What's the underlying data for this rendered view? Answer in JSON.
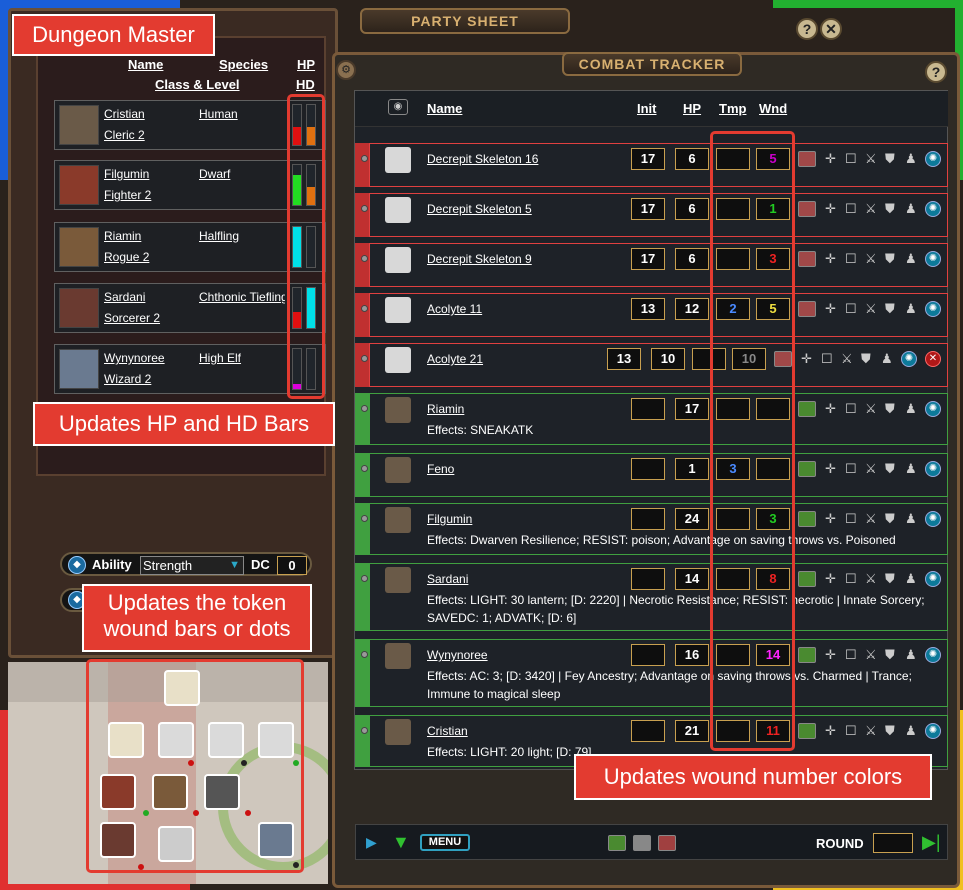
{
  "colors": {
    "callout": "#e33b30",
    "wound_purple": "#cc00cc",
    "wound_green": "#22cc22",
    "wound_red": "#ee2222",
    "wound_yellow": "#f0e040",
    "wound_magenta": "#ff22ff",
    "tmp_blue": "#4a8aff",
    "npc_side": "#c03030",
    "pc_side": "#40a040"
  },
  "callouts": {
    "dm": "Dungeon Master",
    "hp_hd": "Updates HP and HD Bars",
    "token": "Updates the token wound bars or dots",
    "wound_colors": "Updates wound number colors"
  },
  "party_sheet": {
    "title": "PARTY SHEET",
    "headers": {
      "name": "Name",
      "species": "Species",
      "class_level": "Class & Level",
      "hp": "HP",
      "hd": "HD"
    },
    "members": [
      {
        "name": "Cristian",
        "species": "Human",
        "class": "Cleric 2",
        "hp_fill": 0.45,
        "hd_fill": 0.45
      },
      {
        "name": "Filgumin",
        "species": "Dwarf",
        "class": "Fighter 2",
        "hp_fill": 0.75,
        "hd_fill": 0.45
      },
      {
        "name": "Riamin",
        "species": "Halfling",
        "class": "Rogue 2",
        "hp_fill": 1.0,
        "hd_fill": 0.0
      },
      {
        "name": "Sardani",
        "species": "Chthonic Tiefling",
        "class": "Sorcerer 2",
        "hp_fill": 0.4,
        "hd_fill": 1.0
      },
      {
        "name": "Wynynoree",
        "species": "High Elf",
        "class": "Wizard 2",
        "hp_fill": 0.12,
        "hd_fill": 0.0
      }
    ],
    "ability": {
      "label": "Ability",
      "value": "Strength",
      "dc_label": "DC",
      "dc_value": "0"
    }
  },
  "combat_tracker": {
    "title": "COMBAT TRACKER",
    "headers": {
      "name": "Name",
      "init": "Init",
      "hp": "HP",
      "tmp": "Tmp",
      "wnd": "Wnd"
    },
    "rows": [
      {
        "name": "Decrepit Skeleton 16",
        "init": "17",
        "hp": "6",
        "tmp": "",
        "wnd": "5",
        "wnd_color": "#cc00cc",
        "type": "npc"
      },
      {
        "name": "Decrepit Skeleton 5",
        "init": "17",
        "hp": "6",
        "tmp": "",
        "wnd": "1",
        "wnd_color": "#22cc22",
        "type": "npc"
      },
      {
        "name": "Decrepit Skeleton 9",
        "init": "17",
        "hp": "6",
        "tmp": "",
        "wnd": "3",
        "wnd_color": "#ee2222",
        "type": "npc"
      },
      {
        "name": "Acolyte 11",
        "init": "13",
        "hp": "12",
        "tmp": "2",
        "wnd": "5",
        "wnd_color": "#f0e040",
        "type": "npc"
      },
      {
        "name": "Acolyte 21",
        "init": "13",
        "hp": "10",
        "tmp": "",
        "wnd": "10",
        "wnd_color": "#888888",
        "type": "npc-edit"
      },
      {
        "name": "Riamin",
        "init": "",
        "hp": "17",
        "tmp": "",
        "wnd": "",
        "wnd_color": "#ffffff",
        "type": "pc",
        "effects": "Effects: SNEAKATK"
      },
      {
        "name": "Feno",
        "init": "",
        "hp": "1",
        "tmp": "3",
        "wnd": "",
        "wnd_color": "#ffffff",
        "type": "pc-npc"
      },
      {
        "name": "Filgumin",
        "init": "",
        "hp": "24",
        "tmp": "",
        "wnd": "3",
        "wnd_color": "#22cc22",
        "type": "pc",
        "effects": "Effects: Dwarven Resilience; RESIST: poison; Advantage on saving throws vs. Poisoned"
      },
      {
        "name": "Sardani",
        "init": "",
        "hp": "14",
        "tmp": "",
        "wnd": "8",
        "wnd_color": "#ee2222",
        "type": "pc",
        "effects": "Effects: LIGHT: 30 lantern; [D: 2220] | Necrotic Resistance; RESIST: necrotic | Innate Sorcery; SAVEDC: 1; ADVATK; [D: 6]"
      },
      {
        "name": "Wynynoree",
        "init": "",
        "hp": "16",
        "tmp": "",
        "wnd": "14",
        "wnd_color": "#ff22ff",
        "type": "pc",
        "effects": "Effects: AC: 3; [D: 3420] | Fey Ancestry; Advantage on saving throws vs. Charmed | Trance; Immune to magical sleep"
      },
      {
        "name": "Cristian",
        "init": "",
        "hp": "21",
        "tmp": "",
        "wnd": "11",
        "wnd_color": "#ee2222",
        "type": "pc",
        "effects": "Effects: LIGHT: 20 light; [D: 79]"
      }
    ],
    "bottom": {
      "menu": "MENU",
      "round_label": "ROUND",
      "round_value": ""
    }
  }
}
